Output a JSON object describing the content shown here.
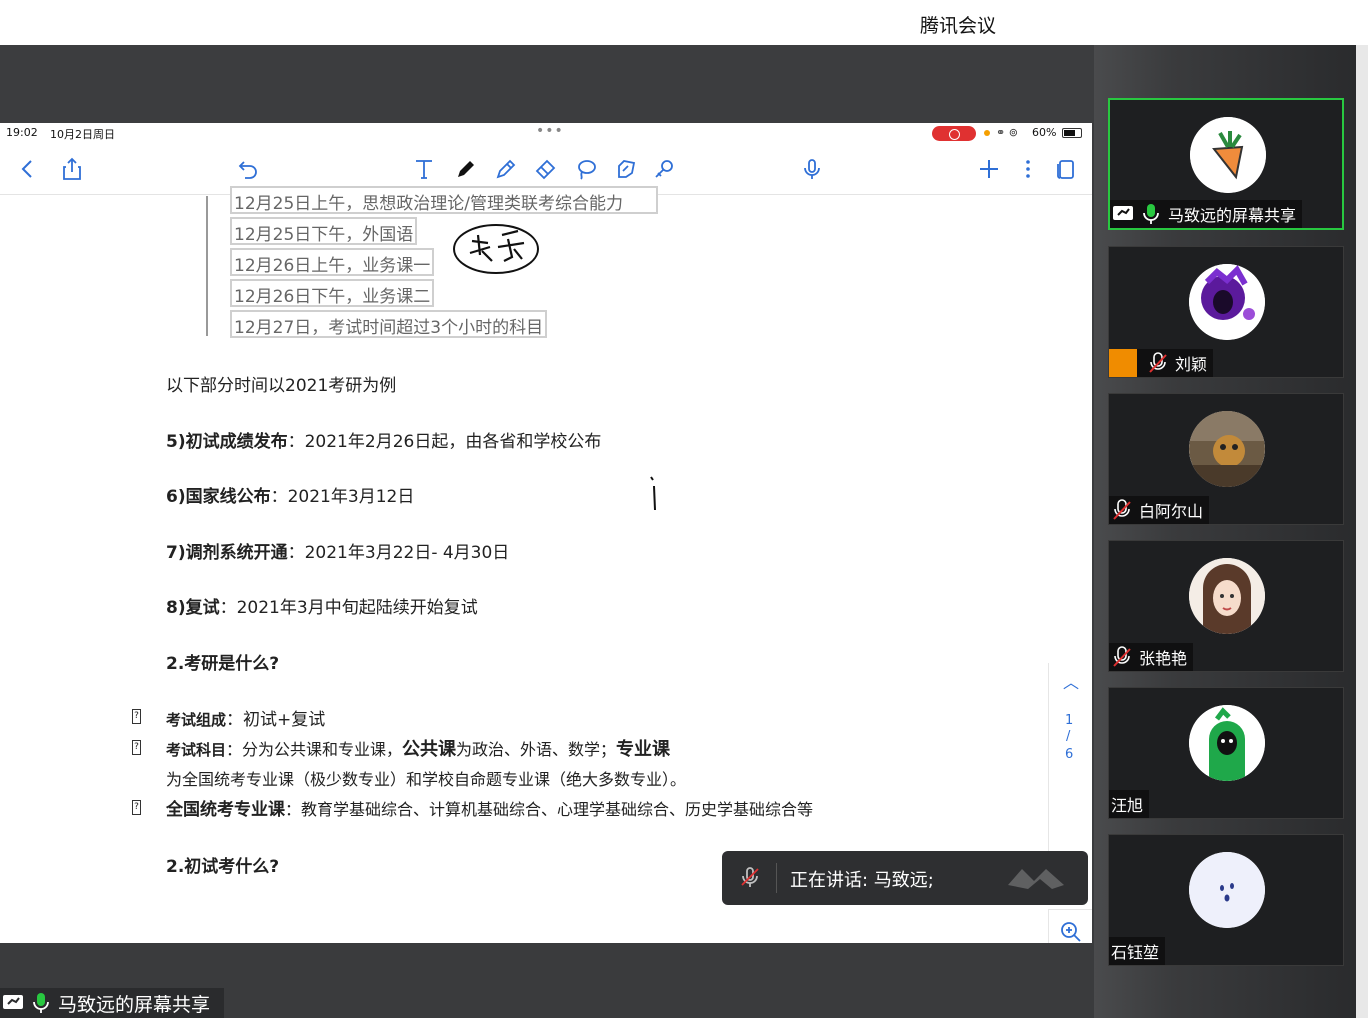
{
  "window": {
    "title": "腾讯会议"
  },
  "ipad_status": {
    "time": "19:02",
    "date": "10月2日周日",
    "dots": "•••",
    "battery": "60%"
  },
  "document": {
    "boxed_lines": [
      "12月25日上午，思想政治理论/管理类联考综合能力",
      "12月25日下午，外国语",
      "12月26日上午，业务课一",
      "12月26日下午，业务课二",
      "12月27日，考试时间超过3个小时的科目"
    ],
    "intro": "以下部分时间以2021考研为例",
    "items": [
      {
        "label": "5)初试成绩发布",
        "sep": "：",
        "text": "2021年2月26日起，由各省和学校公布"
      },
      {
        "label": "6)国家线公布",
        "sep": "：",
        "text": "2021年3月12日"
      },
      {
        "label": "7)调剂系统开通",
        "sep": "：",
        "text": "2021年3月22日- 4月30日"
      },
      {
        "label": "8)复试",
        "sep": "：",
        "text": "2021年3月中旬起陆续开始复试"
      }
    ],
    "heading1": "2.考研是什么?",
    "bullets": {
      "b1_label": "考试组成",
      "b1_text": "：初试+复试",
      "b2_label": "考试科目",
      "b2_text1": "：分为公共课和专业课，",
      "b2_bold1": "公共课",
      "b2_text2": "为政治、外语、数学；",
      "b2_bold2": "专业课",
      "b2_cont": "为全国统考专业课（极少数专业）和学校自命题专业课（绝大多数专业）。",
      "b3_label": "全国统考专业课",
      "b3_text": "：教育学基础综合、计算机基础综合、心理学基础综合、历史学基础综合等"
    },
    "heading2": "2.初试考什么?",
    "bullet_glyph": "?"
  },
  "pager": {
    "current": "1",
    "slash": "/",
    "total": "6"
  },
  "speaking": {
    "text": "正在讲话: 马致远;"
  },
  "share_label": "马致远的屏幕共享",
  "participants": [
    {
      "name": "马致远的屏幕共享",
      "icon": "carrot"
    },
    {
      "name": "刘颖",
      "icon": "purple-character"
    },
    {
      "name": "白阿尔山",
      "icon": "photo"
    },
    {
      "name": "张艳艳",
      "icon": "girl-illustration"
    },
    {
      "name": "汪旭",
      "icon": "green-character"
    },
    {
      "name": "石钰堃",
      "icon": "ghost"
    }
  ]
}
